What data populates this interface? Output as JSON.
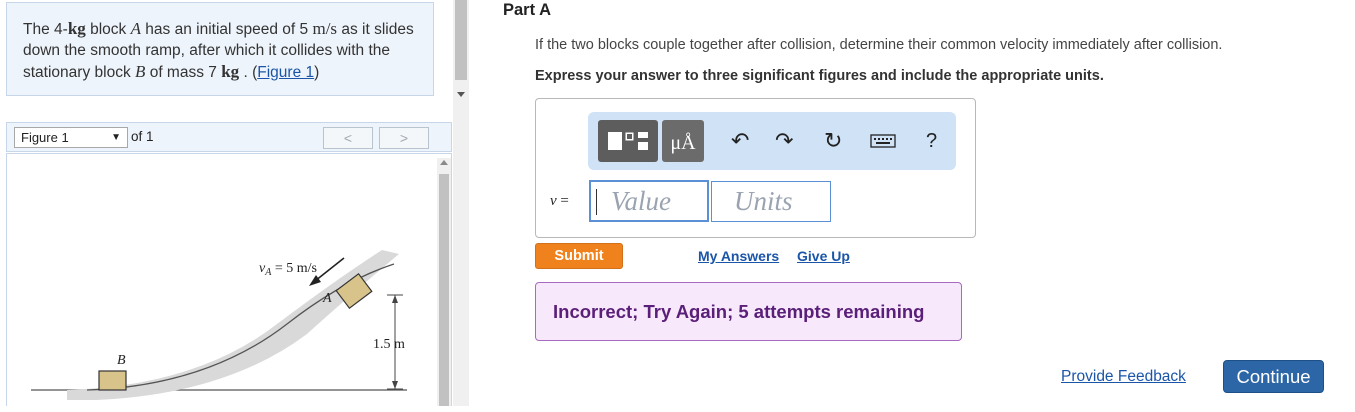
{
  "problem": {
    "text_1": "The 4-",
    "unit_kg_1": "kg",
    "text_2": " block ",
    "block_a": "A",
    "text_3": " has an initial speed of 5 ",
    "unit_speed": "m/s",
    "text_4": " as it slides down the smooth ramp, after which it collides with the stationary block ",
    "block_b": "B",
    "text_5": " of mass 7 ",
    "unit_kg_2": "kg",
    "text_6": " . (",
    "figure_link": "Figure 1",
    "text_7": ")"
  },
  "figure_nav": {
    "selected": "Figure 1",
    "of_label": "of 1",
    "prev_glyph": "<",
    "next_glyph": ">"
  },
  "figure": {
    "velocity_label": "v",
    "velocity_sub": "A",
    "velocity_value": " = 5 m/s",
    "block_a_label": "A",
    "block_b_label": "B",
    "height_label": "1.5 m"
  },
  "part": {
    "title": "Part A",
    "question": "If the two blocks couple together after collision, determine their common velocity immediately after collision.",
    "instruction": "Express your answer to three significant figures and include the appropriate units."
  },
  "answer": {
    "variable": "v",
    "equals": " =",
    "value_placeholder": "Value",
    "units_placeholder": "Units",
    "units_button": "μÅ",
    "help_glyph": "?"
  },
  "actions": {
    "submit": "Submit",
    "my_answers": "My Answers",
    "give_up": "Give Up"
  },
  "feedback": {
    "message": "Incorrect; Try Again; 5 attempts remaining"
  },
  "footer": {
    "provide_feedback": "Provide Feedback",
    "continue": "Continue"
  },
  "colors": {
    "submit": "#f0821e",
    "continue": "#2d66a6",
    "feedback_bg": "#f7e8fb",
    "feedback_text": "#5a1f78",
    "toolbar_bg": "#cfe2f6",
    "link": "#1a55a8"
  }
}
